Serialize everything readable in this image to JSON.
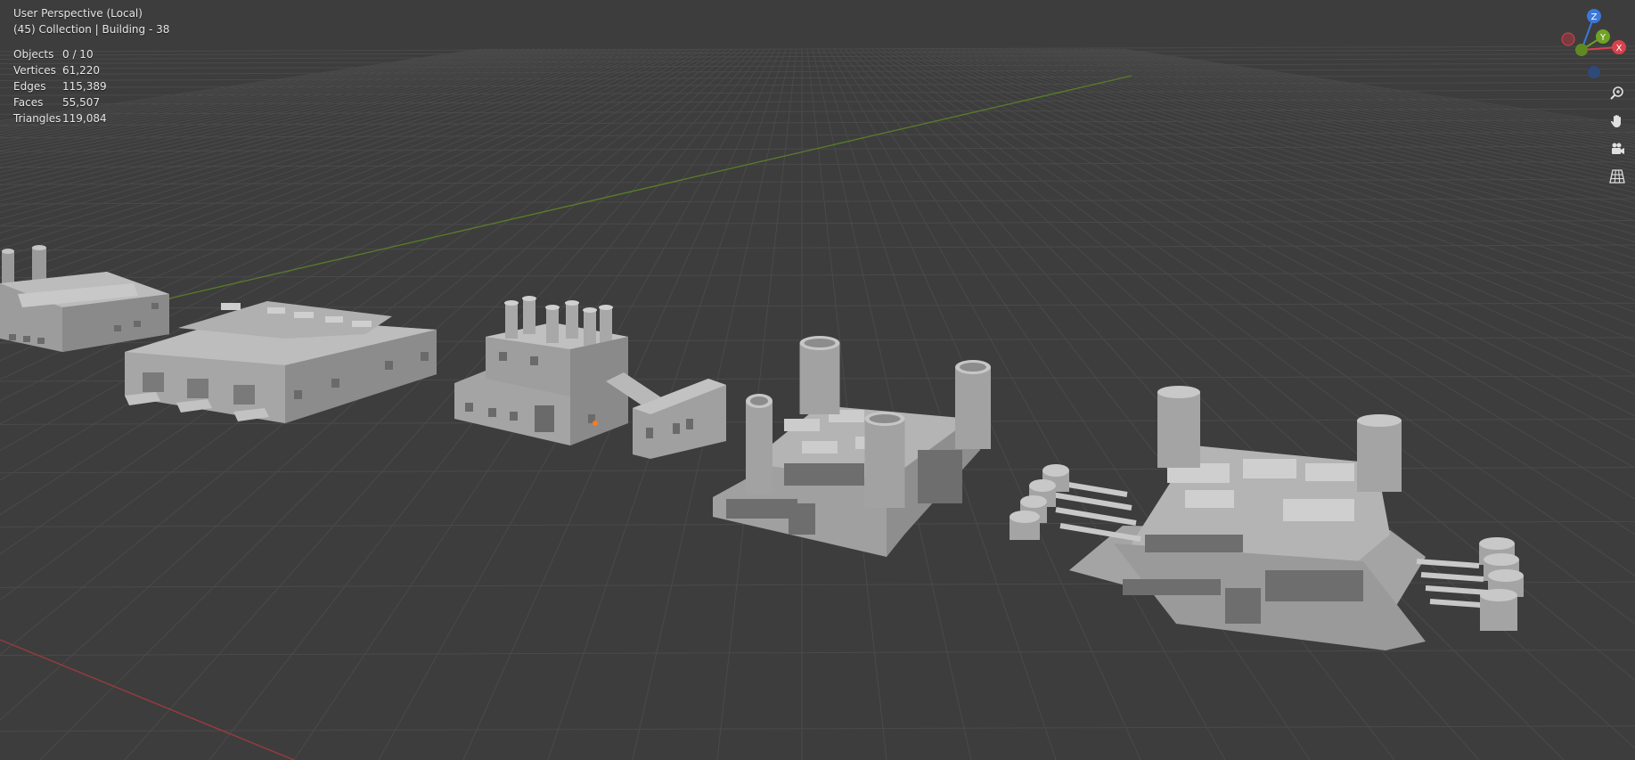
{
  "viewport": {
    "perspective_label": "User Perspective (Local)",
    "collection_label": "(45) Collection | Building - 38"
  },
  "stats": [
    {
      "label": "Objects",
      "value": "0 / 10"
    },
    {
      "label": "Vertices",
      "value": "61,220"
    },
    {
      "label": "Edges",
      "value": "115,389"
    },
    {
      "label": "Faces",
      "value": "55,507"
    },
    {
      "label": "Triangles",
      "value": "119,084"
    }
  ],
  "gizmo": {
    "z_label": "Z",
    "y_label": "Y",
    "x_label": "X",
    "x_color": "#d9424c",
    "y_color": "#6fa326",
    "z_color": "#3b78d8"
  },
  "nav_tools": [
    {
      "name": "zoom-icon"
    },
    {
      "name": "hand-pan-icon"
    },
    {
      "name": "camera-icon"
    },
    {
      "name": "grid-perspective-icon"
    }
  ],
  "colors": {
    "background": "#3d3d3d",
    "grid": "#4a4a4a",
    "x_axis_line": "#9a3a3f",
    "y_axis_line": "#587a2b",
    "building_light": "#b8b8b8",
    "building_mid": "#9a9a9a",
    "building_dark": "#7a7a7a"
  }
}
